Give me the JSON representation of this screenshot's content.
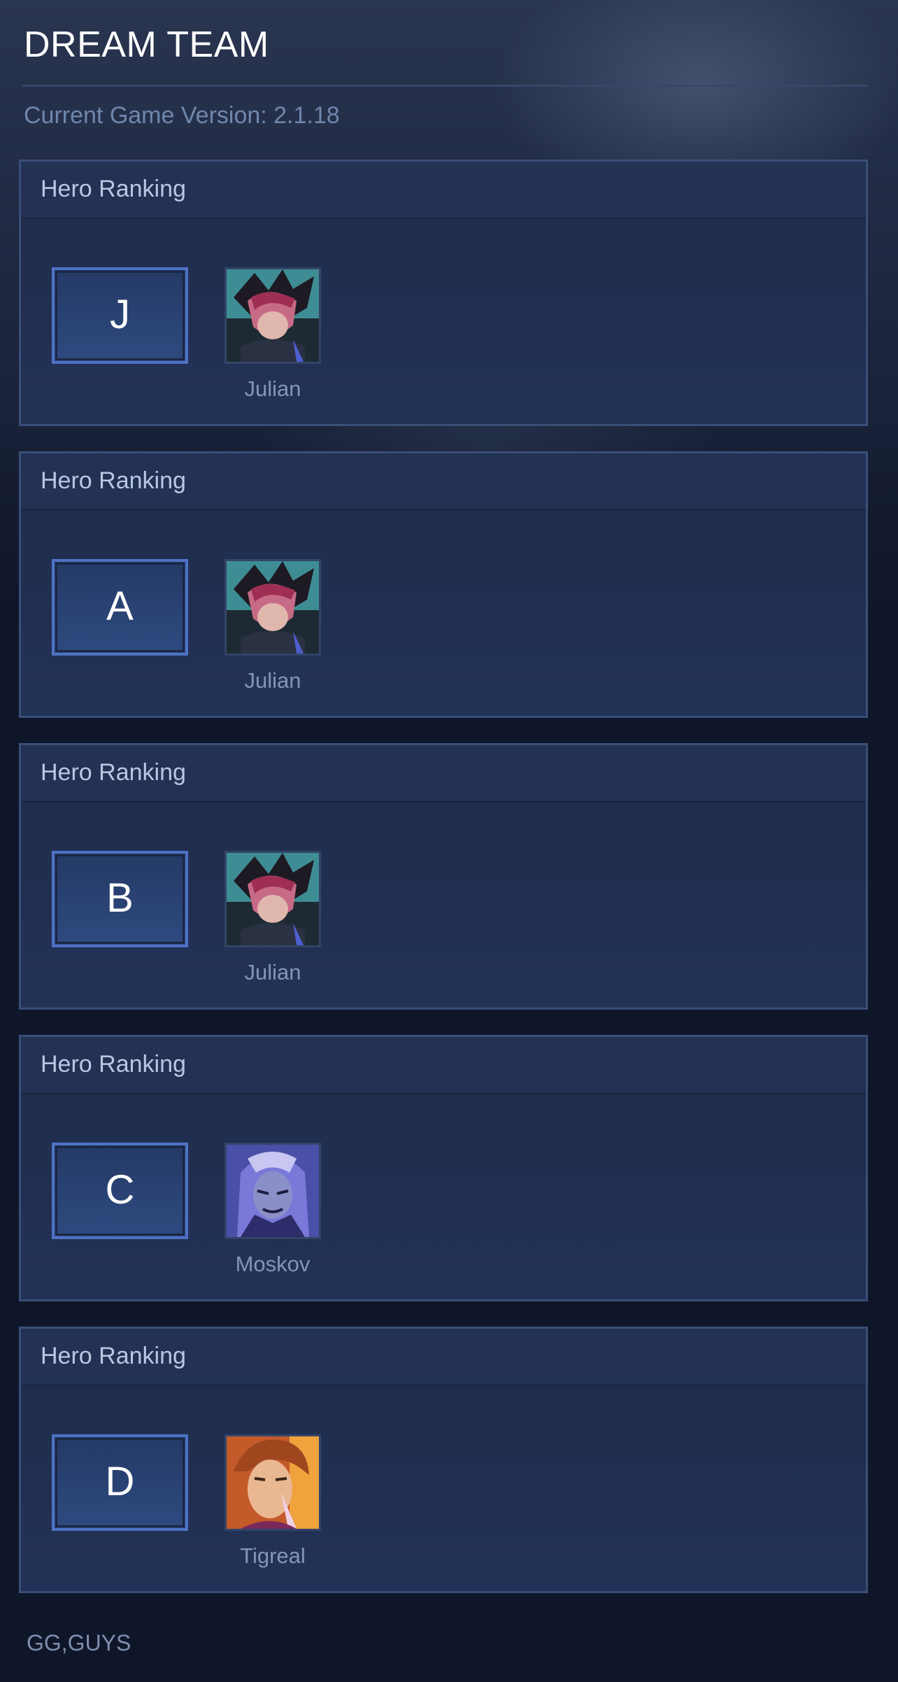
{
  "app": {
    "title": "DREAM TEAM",
    "version_text": "Current Game Version: 2.1.18",
    "footer": "GG,GUYS"
  },
  "rankings": [
    {
      "header": "Hero Ranking",
      "tier": "J",
      "hero": {
        "name": "Julian",
        "portrait_icon": "julian-portrait"
      }
    },
    {
      "header": "Hero Ranking",
      "tier": "A",
      "hero": {
        "name": "Julian",
        "portrait_icon": "julian-portrait"
      }
    },
    {
      "header": "Hero Ranking",
      "tier": "B",
      "hero": {
        "name": "Julian",
        "portrait_icon": "julian-portrait"
      }
    },
    {
      "header": "Hero Ranking",
      "tier": "C",
      "hero": {
        "name": "Moskov",
        "portrait_icon": "moskov-portrait"
      }
    },
    {
      "header": "Hero Ranking",
      "tier": "D",
      "hero": {
        "name": "Tigreal",
        "portrait_icon": "tigreal-portrait"
      }
    }
  ],
  "colors": {
    "background": "#10162a",
    "panel": "#223257",
    "panel_border": "#3a4f78",
    "tier_border": "#4e72c4",
    "title": "#ffffff",
    "version": "#6f87ad"
  }
}
